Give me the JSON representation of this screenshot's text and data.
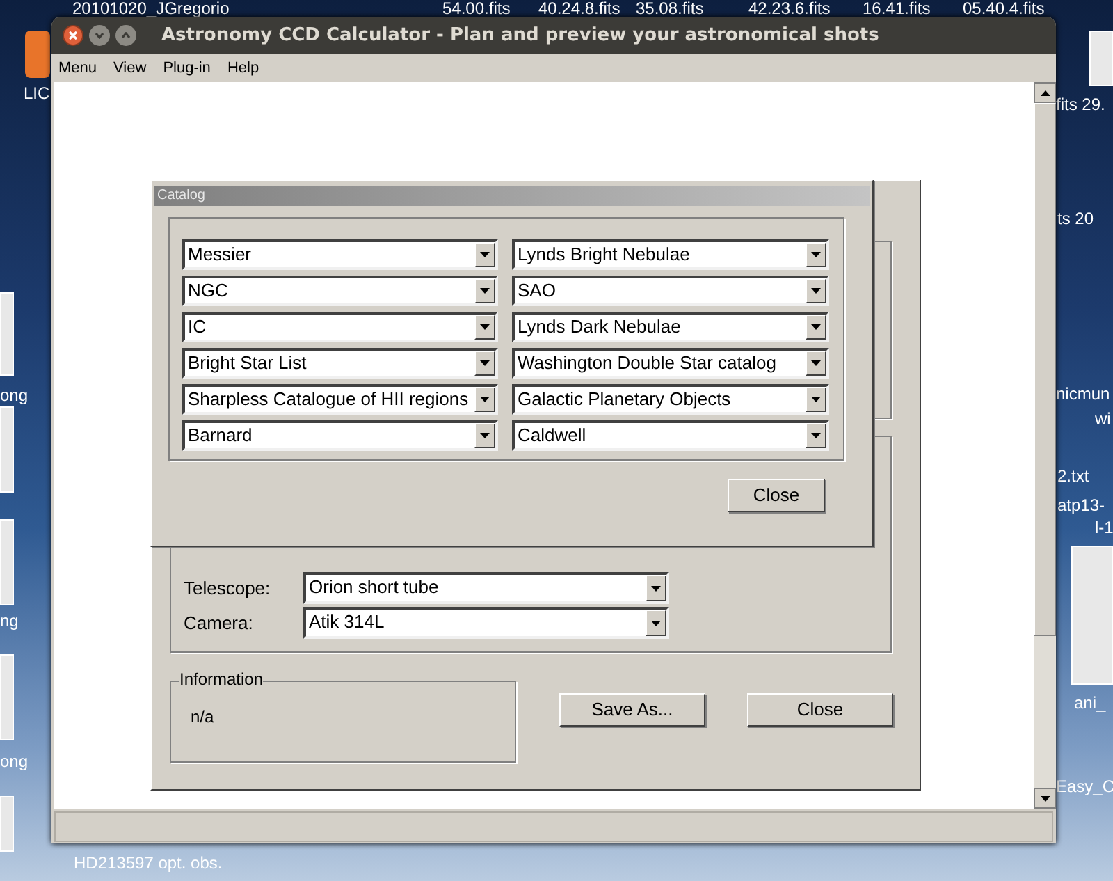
{
  "desktop": {
    "labels": [
      "20101020_JGregorio",
      "54.00.fits",
      "40.24.8.fits",
      "35.08.fits",
      "42.23.6.fits",
      "16.41.fits",
      "05.40.4.fits",
      "LIC",
      "fits 29.",
      "ts  20",
      "ong",
      "nicmun",
      "wi",
      "2.txt",
      "atp13-",
      "l-1",
      "ng",
      "ani_",
      "ong",
      "Easy_C",
      "HD213597 opt. obs."
    ]
  },
  "window": {
    "title": "Astronomy CCD Calculator - Plan and preview your astronomical shots",
    "menu": [
      "Menu",
      "View",
      "Plug-in",
      "Help"
    ]
  },
  "settings_dialog": {
    "fields": [
      {
        "label": "Telescope:",
        "value": "Orion short tube"
      },
      {
        "label": "Camera:",
        "value": "Atik 314L"
      }
    ],
    "information": {
      "title": "Information",
      "text": "n/a"
    },
    "buttons": [
      "Save As...",
      "Close"
    ]
  },
  "catalog_dialog": {
    "title": "Catalog",
    "left": [
      "Messier",
      "NGC",
      "IC",
      "Bright Star List",
      "Sharpless Catalogue of HII regions",
      "Barnard"
    ],
    "right": [
      "Lynds Bright Nebulae",
      "SAO",
      "Lynds Dark Nebulae",
      "Washington Double Star catalog",
      "Galactic Planetary Objects",
      "Caldwell"
    ],
    "button": "Close"
  }
}
